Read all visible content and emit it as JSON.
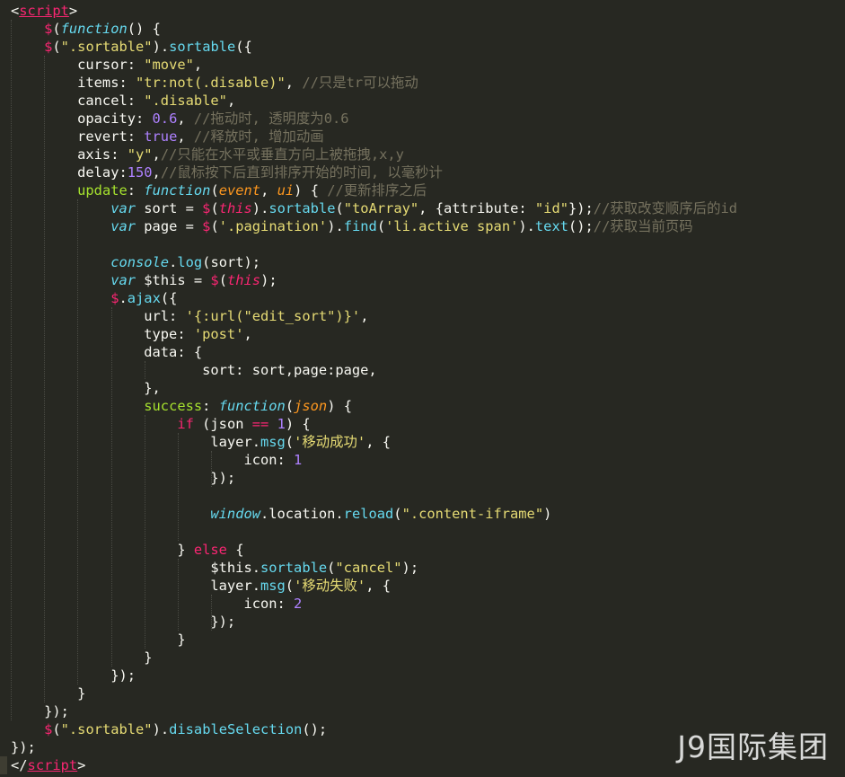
{
  "editor": {
    "watermark": "J9国际集团",
    "colors": {
      "background": "#272822",
      "plain": "#f8f8f2",
      "keyword": "#f92672",
      "function_name": "#66d9ef",
      "string": "#e6db74",
      "number": "#ae81ff",
      "comment": "#75715e",
      "property": "#a6e22e",
      "param": "#fd971f"
    },
    "lines": [
      [
        [
          "p",
          "<"
        ],
        [
          "tagu",
          "script"
        ],
        [
          "p",
          ">"
        ]
      ],
      [
        [
          "p",
          "    "
        ],
        [
          "kw",
          "$"
        ],
        [
          "p",
          "("
        ],
        [
          "fi",
          "function"
        ],
        [
          "p",
          "() {"
        ]
      ],
      [
        [
          "p",
          "    "
        ],
        [
          "kw",
          "$"
        ],
        [
          "p",
          "("
        ],
        [
          "st",
          "\".sortable\""
        ],
        [
          "p",
          ")."
        ],
        [
          "fn",
          "sortable"
        ],
        [
          "p",
          "({"
        ]
      ],
      [
        [
          "p",
          "        cursor: "
        ],
        [
          "st",
          "\"move\""
        ],
        [
          "p",
          ","
        ]
      ],
      [
        [
          "p",
          "        items: "
        ],
        [
          "st",
          "\"tr:not(.disable)\""
        ],
        [
          "p",
          ", "
        ],
        [
          "cm",
          "//只是tr可以拖动"
        ]
      ],
      [
        [
          "p",
          "        cancel: "
        ],
        [
          "st",
          "\".disable\""
        ],
        [
          "p",
          ","
        ]
      ],
      [
        [
          "p",
          "        opacity: "
        ],
        [
          "nu",
          "0.6"
        ],
        [
          "p",
          ", "
        ],
        [
          "cm",
          "//拖动时, 透明度为0.6"
        ]
      ],
      [
        [
          "p",
          "        revert: "
        ],
        [
          "nu",
          "true"
        ],
        [
          "p",
          ", "
        ],
        [
          "cm",
          "//释放时, 增加动画"
        ]
      ],
      [
        [
          "p",
          "        axis: "
        ],
        [
          "st",
          "\"y\""
        ],
        [
          "p",
          ","
        ],
        [
          "cm",
          "//只能在水平或垂直方向上被拖拽,x,y"
        ]
      ],
      [
        [
          "p",
          "        delay:"
        ],
        [
          "nu",
          "150"
        ],
        [
          "p",
          ","
        ],
        [
          "cm",
          "//鼠标按下后直到排序开始的时间, 以毫秒计"
        ]
      ],
      [
        [
          "p",
          "        "
        ],
        [
          "pr",
          "update"
        ],
        [
          "p",
          ": "
        ],
        [
          "fi",
          "function"
        ],
        [
          "p",
          "("
        ],
        [
          "pa",
          "event"
        ],
        [
          "p",
          ", "
        ],
        [
          "pa",
          "ui"
        ],
        [
          "p",
          ") { "
        ],
        [
          "cm",
          "//更新排序之后"
        ]
      ],
      [
        [
          "p",
          "            "
        ],
        [
          "fi",
          "var"
        ],
        [
          "p",
          " sort = "
        ],
        [
          "kw",
          "$"
        ],
        [
          "p",
          "("
        ],
        [
          "ki",
          "this"
        ],
        [
          "p",
          ")."
        ],
        [
          "fn",
          "sortable"
        ],
        [
          "p",
          "("
        ],
        [
          "st",
          "\"toArray\""
        ],
        [
          "p",
          ", {attribute: "
        ],
        [
          "st",
          "\"id\""
        ],
        [
          "p",
          "});"
        ],
        [
          "cm",
          "//获取改变顺序后的id"
        ]
      ],
      [
        [
          "p",
          "            "
        ],
        [
          "fi",
          "var"
        ],
        [
          "p",
          " page = "
        ],
        [
          "kw",
          "$"
        ],
        [
          "p",
          "("
        ],
        [
          "st",
          "'.pagination'"
        ],
        [
          "p",
          ")."
        ],
        [
          "fn",
          "find"
        ],
        [
          "p",
          "("
        ],
        [
          "st",
          "'li.active span'"
        ],
        [
          "p",
          ")."
        ],
        [
          "fn",
          "text"
        ],
        [
          "p",
          "();"
        ],
        [
          "cm",
          "//获取当前页码"
        ]
      ],
      [
        [
          "p",
          ""
        ]
      ],
      [
        [
          "p",
          "            "
        ],
        [
          "fi",
          "console"
        ],
        [
          "p",
          "."
        ],
        [
          "fn",
          "log"
        ],
        [
          "p",
          "(sort);"
        ]
      ],
      [
        [
          "p",
          "            "
        ],
        [
          "fi",
          "var"
        ],
        [
          "p",
          " $this = "
        ],
        [
          "kw",
          "$"
        ],
        [
          "p",
          "("
        ],
        [
          "ki",
          "this"
        ],
        [
          "p",
          ");"
        ]
      ],
      [
        [
          "p",
          "            "
        ],
        [
          "kw",
          "$"
        ],
        [
          "p",
          "."
        ],
        [
          "fn",
          "ajax"
        ],
        [
          "p",
          "({"
        ]
      ],
      [
        [
          "p",
          "                url: "
        ],
        [
          "st",
          "'{:url(\"edit_sort\")}'"
        ],
        [
          "p",
          ","
        ]
      ],
      [
        [
          "p",
          "                type: "
        ],
        [
          "st",
          "'post'"
        ],
        [
          "p",
          ","
        ]
      ],
      [
        [
          "p",
          "                data: {"
        ]
      ],
      [
        [
          "p",
          "                       sort: sort,page:page,"
        ]
      ],
      [
        [
          "p",
          "                },"
        ]
      ],
      [
        [
          "p",
          "                "
        ],
        [
          "pr",
          "success"
        ],
        [
          "p",
          ": "
        ],
        [
          "fi",
          "function"
        ],
        [
          "p",
          "("
        ],
        [
          "pa",
          "json"
        ],
        [
          "p",
          ") {"
        ]
      ],
      [
        [
          "p",
          "                    "
        ],
        [
          "kw",
          "if"
        ],
        [
          "p",
          " (json "
        ],
        [
          "kw",
          "=="
        ],
        [
          "p",
          " "
        ],
        [
          "nu",
          "1"
        ],
        [
          "p",
          ") {"
        ]
      ],
      [
        [
          "p",
          "                        layer."
        ],
        [
          "fn",
          "msg"
        ],
        [
          "p",
          "("
        ],
        [
          "st",
          "'移动成功'"
        ],
        [
          "p",
          ", {"
        ]
      ],
      [
        [
          "p",
          "                            icon: "
        ],
        [
          "nu",
          "1"
        ]
      ],
      [
        [
          "p",
          "                        });"
        ]
      ],
      [
        [
          "p",
          ""
        ]
      ],
      [
        [
          "p",
          "                        "
        ],
        [
          "fi",
          "window"
        ],
        [
          "p",
          ".location."
        ],
        [
          "fn",
          "reload"
        ],
        [
          "p",
          "("
        ],
        [
          "st",
          "\".content-iframe\""
        ],
        [
          "p",
          ")"
        ]
      ],
      [
        [
          "p",
          ""
        ]
      ],
      [
        [
          "p",
          "                    } "
        ],
        [
          "kw",
          "else"
        ],
        [
          "p",
          " {"
        ]
      ],
      [
        [
          "p",
          "                        $this."
        ],
        [
          "fn",
          "sortable"
        ],
        [
          "p",
          "("
        ],
        [
          "st",
          "\"cancel\""
        ],
        [
          "p",
          ");"
        ]
      ],
      [
        [
          "p",
          "                        layer."
        ],
        [
          "fn",
          "msg"
        ],
        [
          "p",
          "("
        ],
        [
          "st",
          "'移动失败'"
        ],
        [
          "p",
          ", {"
        ]
      ],
      [
        [
          "p",
          "                            icon: "
        ],
        [
          "nu",
          "2"
        ]
      ],
      [
        [
          "p",
          "                        });"
        ]
      ],
      [
        [
          "p",
          "                    }"
        ]
      ],
      [
        [
          "p",
          "                }"
        ]
      ],
      [
        [
          "p",
          "            });"
        ]
      ],
      [
        [
          "p",
          "        }"
        ]
      ],
      [
        [
          "p",
          "    });"
        ]
      ],
      [
        [
          "p",
          "    "
        ],
        [
          "kw",
          "$"
        ],
        [
          "p",
          "("
        ],
        [
          "st",
          "\".sortable\""
        ],
        [
          "p",
          ")."
        ],
        [
          "fn",
          "disableSelection"
        ],
        [
          "p",
          "();"
        ]
      ],
      [
        [
          "p",
          "});"
        ]
      ],
      [
        [
          "p",
          "</"
        ],
        [
          "tagu",
          "script"
        ],
        [
          "p",
          ">"
        ]
      ]
    ]
  }
}
